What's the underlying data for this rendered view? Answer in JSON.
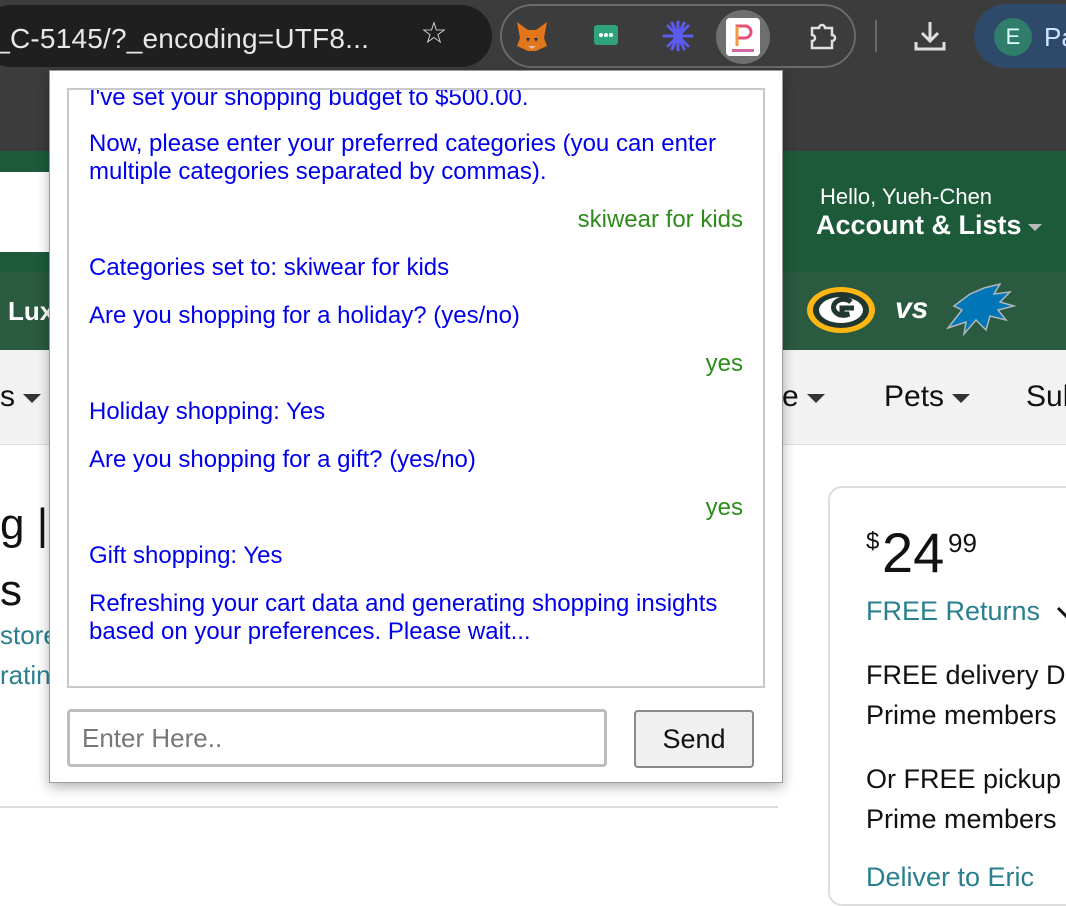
{
  "browser": {
    "url_fragment": "s_C-5145/?_encoding=UTF8...",
    "profile_initial": "E",
    "profile_name_fragment": "Pa",
    "extensions": [
      "metamask-fox-icon",
      "chat-bubble-icon",
      "starburst-icon",
      "promptly-icon",
      "puzzle-icon"
    ]
  },
  "amazon": {
    "greeting": "Hello, Yueh-Chen",
    "account_lists": "Account & Lists",
    "subnav_fragment": "Lux",
    "vs_text": "vs",
    "categories": [
      "s",
      "e",
      "Pets",
      "Sul"
    ],
    "title_fragment_1": "g |",
    "title_fragment_2": "s",
    "store_fragment": "store",
    "rating_fragment": "ratin",
    "price_symbol": "$",
    "price_whole": "24",
    "price_fraction": "99",
    "free_returns": "FREE Returns",
    "free_delivery": "FREE delivery D",
    "prime_members_1": "Prime members",
    "free_pickup": "Or FREE pickup",
    "prime_members_2": "Prime members",
    "deliver_fragment": "Deliver to Eric"
  },
  "popup": {
    "messages": [
      {
        "role": "bot",
        "text": "I've set your shopping budget to $500.00."
      },
      {
        "role": "bot",
        "text": "Now, please enter your preferred categories (you can enter multiple categories separated by commas)."
      },
      {
        "role": "user",
        "text": "skiwear for kids"
      },
      {
        "role": "bot",
        "text": "Categories set to: skiwear for kids"
      },
      {
        "role": "bot",
        "text": "Are you shopping for a holiday? (yes/no)"
      },
      {
        "role": "user",
        "text": "yes"
      },
      {
        "role": "bot",
        "text": "Holiday shopping: Yes"
      },
      {
        "role": "bot",
        "text": "Are you shopping for a gift? (yes/no)"
      },
      {
        "role": "user",
        "text": "yes"
      },
      {
        "role": "bot",
        "text": "Gift shopping: Yes"
      },
      {
        "role": "bot",
        "text": "Refreshing your cart data and generating shopping insights based on your preferences. Please wait..."
      }
    ],
    "input_placeholder": "Enter Here..",
    "input_value": "",
    "send_label": "Send"
  },
  "colors": {
    "bot_text": "#0000ee",
    "user_text": "#2e8b1c",
    "amazon_header": "#1c5a3a",
    "link_teal": "#2a7f8f"
  }
}
